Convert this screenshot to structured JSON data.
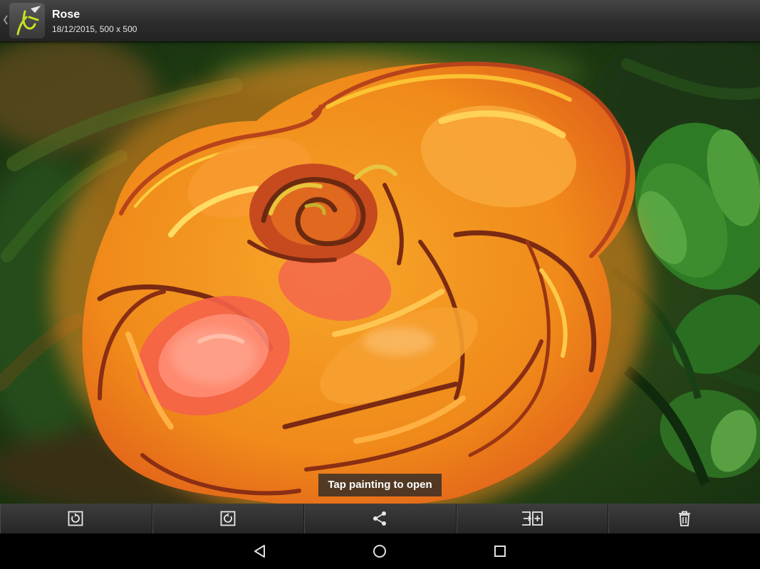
{
  "header": {
    "title": "Rose",
    "subtitle": "18/12/2015, 500 x 500",
    "up_icon": "chevron-left-icon",
    "app_icon": "brush-app-icon"
  },
  "painting": {
    "toast": "Tap painting to open"
  },
  "toolbar": {
    "items": [
      {
        "icon": "rotate-left-icon"
      },
      {
        "icon": "rotate-right-icon"
      },
      {
        "icon": "share-icon"
      },
      {
        "icon": "export-icon"
      },
      {
        "icon": "delete-icon"
      }
    ]
  },
  "navbar": {
    "items": [
      {
        "icon": "back-triangle-icon"
      },
      {
        "icon": "home-circle-icon"
      },
      {
        "icon": "recents-square-icon"
      }
    ]
  },
  "colors": {
    "accent": "#c7e21f",
    "bar": "#2e2e2e",
    "background_green": "#1c3f16",
    "rose_orange": "#f2891a"
  }
}
